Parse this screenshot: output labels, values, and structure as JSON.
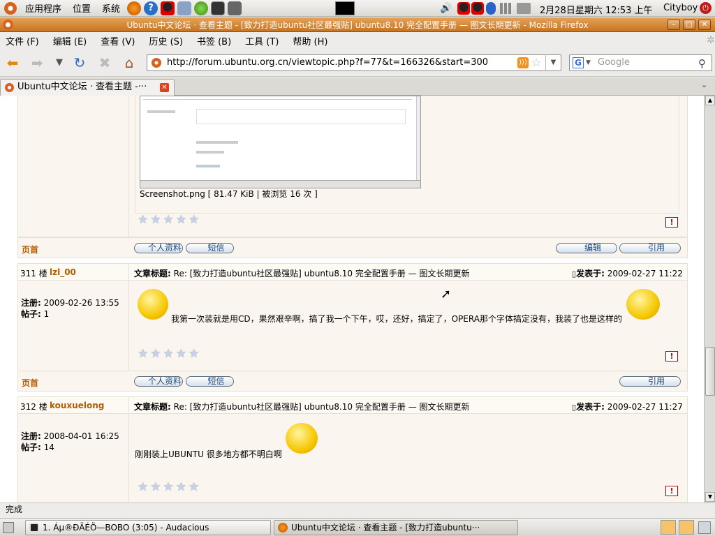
{
  "panel": {
    "menus": [
      "应用程序",
      "位置",
      "系统"
    ],
    "datetime": "2月28日星期六 12:53 上午",
    "user": "Cityboy"
  },
  "window": {
    "title": "Ubuntu中文论坛 · 查看主题 - [致力打造ubuntu社区最强贴] ubuntu8.10 完全配置手册 — 图文长期更新 - Mozilla Firefox"
  },
  "menubar": [
    "文件 (F)",
    "编辑 (E)",
    "查看 (V)",
    "历史 (S)",
    "书签 (B)",
    "工具 (T)",
    "帮助 (H)"
  ],
  "nav": {
    "url": "http://forum.ubuntu.org.cn/viewtopic.php?f=77&t=166326&start=300",
    "search_placeholder": "Google"
  },
  "tab": {
    "label": "Ubuntu中文论坛 · 查看主题 -···"
  },
  "attachment": {
    "caption": "Screenshot.png [ 81.47 KiB | 被浏览 16 次 ]"
  },
  "actions": {
    "top": "页首",
    "profile": "个人资料",
    "pm": "短信",
    "edit": "编辑",
    "quote": "引用"
  },
  "posts": [
    {
      "floor": "311 楼",
      "author": "lzl_00",
      "reg_label": "注册:",
      "reg": "2009-02-26 13:55",
      "posts_label": "帖子:",
      "posts": "1",
      "title_label": "文章标题:",
      "title": "Re: [致力打造ubuntu社区最强贴] ubuntu8.10 完全配置手册 — 图文长期更新",
      "time_label": "发表于:",
      "time": "2009-02-27 11:22",
      "body": "我第一次装就是用CD，果然艰辛啊，搞了我一个下午，哎，还好，搞定了，OPERA那个字体搞定没有，我装了也是这样的"
    },
    {
      "floor": "312 楼",
      "author": "kouxuelong",
      "reg_label": "注册:",
      "reg": "2008-04-01 16:25",
      "posts_label": "帖子:",
      "posts": "14",
      "title_label": "文章标题:",
      "title": "Re: [致力打造ubuntu社区最强贴] ubuntu8.10 完全配置手册 — 图文长期更新",
      "time_label": "发表于:",
      "time": "2009-02-27 11:27",
      "body": "刚刚装上UBUNTU 很多地方都不明白啊"
    }
  ],
  "statusbar": {
    "text": "完成"
  },
  "taskbar": [
    {
      "label": "1. Áµ®ÐÃÉÖ—BOBO (3:05) - Audacious"
    },
    {
      "label": "Ubuntu中文论坛 · 查看主题 - [致力打造ubuntu···"
    }
  ]
}
